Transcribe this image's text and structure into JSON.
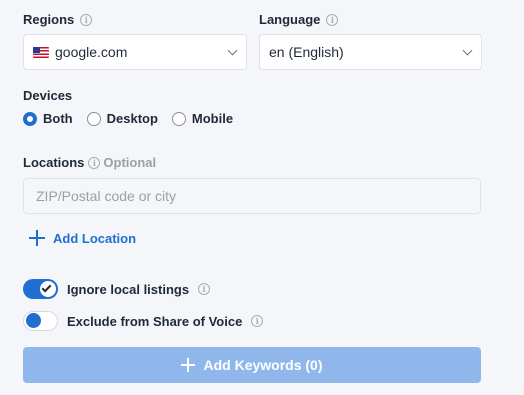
{
  "regions": {
    "label": "Regions",
    "selected": "google.com",
    "flag_icon": "us-flag-icon"
  },
  "language": {
    "label": "Language",
    "selected": "en (English)"
  },
  "devices": {
    "label": "Devices",
    "options": [
      "Both",
      "Desktop",
      "Mobile"
    ],
    "selected": "Both"
  },
  "locations": {
    "label": "Locations",
    "optional_text": "Optional",
    "placeholder": "ZIP/Postal code or city",
    "add_label": "Add Location"
  },
  "toggles": {
    "ignore_local": {
      "label": "Ignore local listings",
      "on": true
    },
    "exclude_sov": {
      "label": "Exclude from Share of Voice",
      "on": false
    }
  },
  "submit": {
    "label": "Add Keywords (0)",
    "enabled": false
  },
  "colors": {
    "accent": "#1f6fd1",
    "disabled_button": "#8fb7ec",
    "background": "#f4f6f9"
  }
}
